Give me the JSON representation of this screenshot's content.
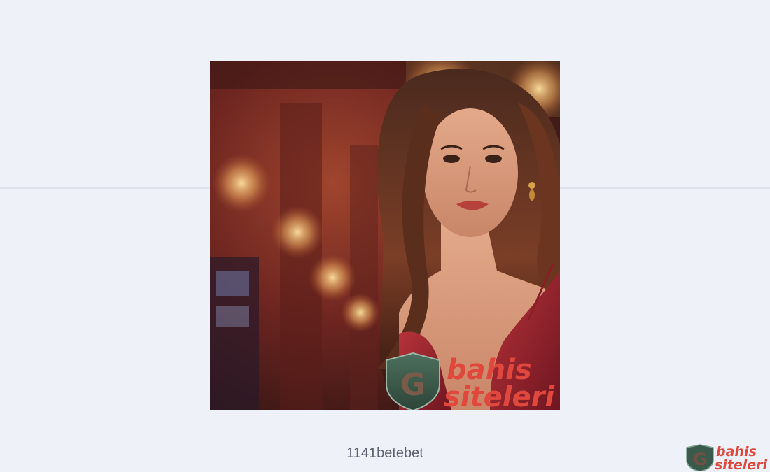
{
  "hero": {
    "brand_line1": "bahis",
    "brand_line2": "siteleri",
    "shield_letter": "G"
  },
  "caption": {
    "text": "1141betebet"
  },
  "corner_logo": {
    "line1": "bahis",
    "line2": "siteleri",
    "shield_letter": "G"
  },
  "colors": {
    "page_background": "#eef1f8",
    "brand_red": "#e0483d",
    "shield_green": "#3b5a4b",
    "caption_text": "#5d6270"
  }
}
